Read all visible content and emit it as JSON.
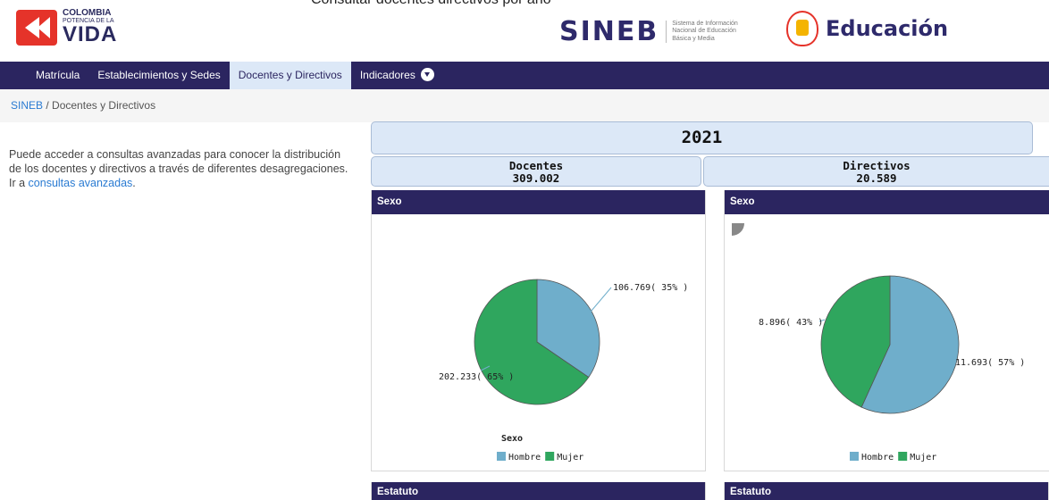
{
  "page": {
    "top_clipped_text": "Consultar docentes directivos por año"
  },
  "header": {
    "colombia_logo": {
      "line1": "COLOMBIA",
      "line2": "POTENCIA DE LA",
      "line3": "VIDA"
    },
    "sineb_logo": {
      "word": "SINEB",
      "sub1": "Sistema de Información",
      "sub2": "Nacional de Educación",
      "sub3": "Básica y Media"
    },
    "education_logo": {
      "word": "Educación"
    }
  },
  "nav": {
    "items": [
      {
        "label": "Matrícula"
      },
      {
        "label": "Establecimientos y Sedes"
      },
      {
        "label": "Docentes y Directivos",
        "active": true
      },
      {
        "label": "Indicadores"
      }
    ]
  },
  "breadcrumb": {
    "root": "SINEB",
    "separator": "/",
    "current": "Docentes y Directivos"
  },
  "intro": {
    "text": "Puede acceder a consultas avanzadas para conocer la distribución de los docentes y directivos a través de diferentes desagregaciones.  Ir a ",
    "link": "consultas avanzadas",
    "after": "."
  },
  "summary": {
    "year": "2021",
    "docentes_label": "Docentes",
    "docentes_value": "309.002",
    "directivos_label": "Directivos",
    "directivos_value": "20.589"
  },
  "panels": {
    "docentes_sexo_title": "Sexo",
    "directivos_sexo_title": "Sexo",
    "docentes_estatuto_title": "Estatuto",
    "directivos_estatuto_title": "Estatuto"
  },
  "chart_data": [
    {
      "type": "pie",
      "legend_title": "Sexo",
      "legend_placement": "bottom",
      "categories": [
        "Hombre",
        "Mujer"
      ],
      "values": [
        106769,
        202233
      ],
      "slice_labels": [
        "106.769( 35% )",
        "202.233( 65% )"
      ],
      "colors": [
        "#6faecb",
        "#2fa65e"
      ]
    },
    {
      "type": "pie",
      "legend_title": "",
      "legend_placement": "bottom",
      "categories": [
        "Hombre",
        "Mujer"
      ],
      "values": [
        11693,
        8896
      ],
      "slice_labels": [
        "11.693( 57% )",
        "8.896( 43% )"
      ],
      "colors": [
        "#6faecb",
        "#2fa65e"
      ]
    }
  ],
  "colors": {
    "navbar": "#2b2560",
    "active_tab_bg": "#dce8f7",
    "link": "#2a7bd2"
  }
}
